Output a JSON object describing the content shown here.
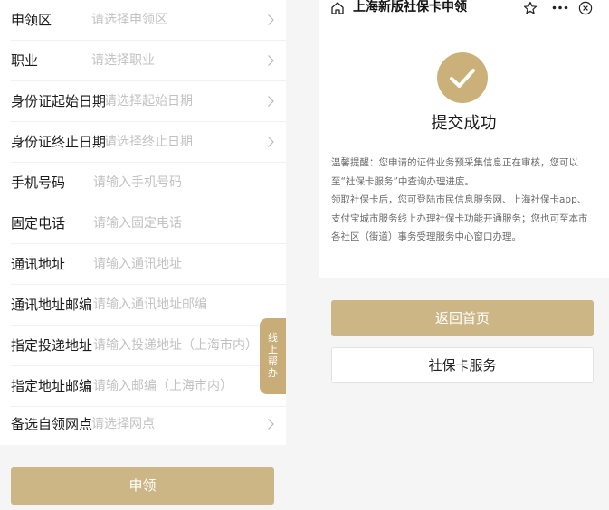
{
  "form": {
    "rows": [
      {
        "label": "申领区",
        "placeholder": "请选择申领区",
        "arrow": true
      },
      {
        "label": "职业",
        "placeholder": "请选择职业",
        "arrow": true
      },
      {
        "label": "身份证起始日期",
        "placeholder": "请选择起始日期",
        "arrow": true
      },
      {
        "label": "身份证终止日期",
        "placeholder": "请选择终止日期",
        "arrow": true
      },
      {
        "label": "手机号码",
        "placeholder": "请输入手机号码",
        "arrow": false
      },
      {
        "label": "固定电话",
        "placeholder": "请输入固定电话",
        "arrow": false
      },
      {
        "label": "通讯地址",
        "placeholder": "请输入通讯地址",
        "arrow": false
      },
      {
        "label": "通讯地址邮编",
        "placeholder": "请输入通讯地址邮编",
        "arrow": false
      },
      {
        "label": "指定投递地址",
        "placeholder": "请输入投递地址（上海市内）",
        "arrow": false
      },
      {
        "label": "指定地址邮编",
        "placeholder": "请输入邮编（上海市内）",
        "arrow": false
      },
      {
        "label": "备选自领网点",
        "placeholder": "请选择网点",
        "arrow": true
      }
    ],
    "submit_label": "申领"
  },
  "help_tab": {
    "chars": [
      "线",
      "上",
      "帮",
      "办"
    ]
  },
  "header": {
    "title": "上海新版社保卡申领"
  },
  "result": {
    "title": "提交成功",
    "notice_1": "温馨提醒：您申请的证件业务预采集信息正在审核，您可以至“社保卡服务”中查询办理进度。",
    "notice_2": "领取社保卡后，您可登陆市民信息服务网、上海社保卡app、支付宝城市服务线上办理社保卡功能开通服务；您也可至本市各社区（街道）事务受理服务中心窗口办理。"
  },
  "buttons": {
    "home_label": "返回首页",
    "service_label": "社保卡服务"
  },
  "colors": {
    "accent": "#ccb686",
    "success_icon": "#cbb07a"
  },
  "icons": [
    "home-icon",
    "star-icon",
    "more-icon",
    "close-icon",
    "check-icon",
    "chevron-right-icon"
  ]
}
